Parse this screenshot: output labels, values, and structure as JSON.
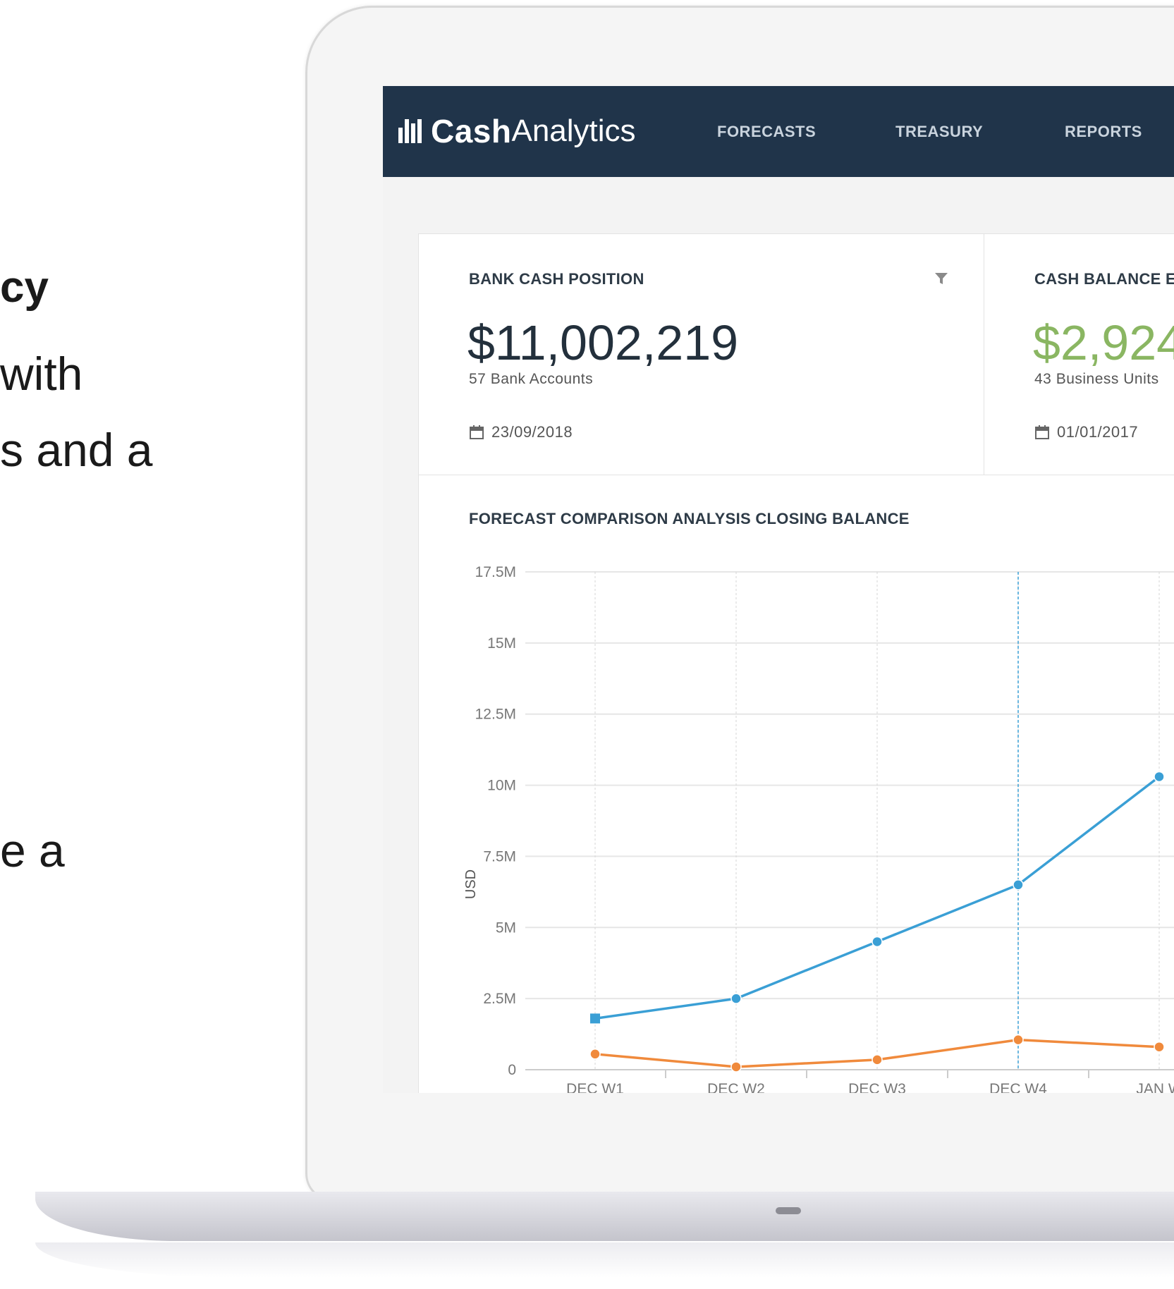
{
  "side_text": {
    "line1": "cy",
    "line2": "with",
    "line3": "s and a",
    "line4": "e a"
  },
  "app": {
    "logo_bold": "Cash",
    "logo_thin": "Analytics",
    "nav": [
      "FORECASTS",
      "TREASURY",
      "REPORTS"
    ]
  },
  "cards": {
    "bank": {
      "title": "BANK CASH POSITION",
      "value": "$11,002,219",
      "subtitle": "57 Bank Accounts",
      "date": "23/09/2018"
    },
    "balance": {
      "title": "CASH BALANCE EN",
      "value": "$2,924",
      "subtitle": "43 Business Units",
      "date": "01/01/2017"
    }
  },
  "chart_data": {
    "type": "line",
    "title": "FORECAST COMPARISON ANALYSIS CLOSING BALANCE",
    "ylabel": "USD",
    "ylim": [
      0,
      17500000
    ],
    "yticks": [
      "0",
      "2.5M",
      "5M",
      "7.5M",
      "10M",
      "12.5M",
      "15M",
      "17.5M"
    ],
    "categories": [
      "DEC W1",
      "DEC W2",
      "DEC W3",
      "DEC W4",
      "JAN W"
    ],
    "series": [
      {
        "color": "#3a9fd5",
        "values": [
          1800000,
          2500000,
          4500000,
          6500000,
          10300000
        ]
      },
      {
        "color": "#f08a3c",
        "values": [
          550000,
          100000,
          350000,
          1050000,
          800000
        ]
      }
    ],
    "highlight_category": "DEC W4"
  }
}
